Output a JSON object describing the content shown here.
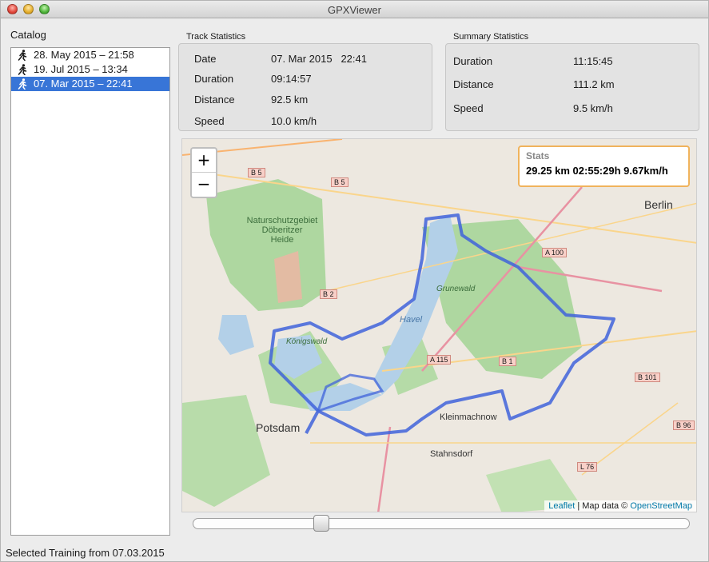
{
  "window": {
    "title": "GPXViewer"
  },
  "catalog": {
    "label": "Catalog",
    "items": [
      {
        "label": "28. May 2015 – 21:58",
        "icon": "runner-icon",
        "selected": false
      },
      {
        "label": "19. Jul 2015 – 13:34",
        "icon": "runner-icon",
        "selected": false
      },
      {
        "label": "07. Mar 2015 – 22:41",
        "icon": "runner-icon",
        "selected": true
      }
    ]
  },
  "track_stats": {
    "label": "Track Statistics",
    "rows": [
      {
        "key": "Date",
        "value": "07. Mar 2015   22:41"
      },
      {
        "key": "Duration",
        "value": "09:14:57"
      },
      {
        "key": "Distance",
        "value": "92.5 km"
      },
      {
        "key": "Speed",
        "value": "10.0 km/h"
      }
    ]
  },
  "summary_stats": {
    "label": "Summary Statistics",
    "rows": [
      {
        "key": "Duration",
        "value": "11:15:45"
      },
      {
        "key": "Distance",
        "value": "111.2 km"
      },
      {
        "key": "Speed",
        "value": "9.5 km/h"
      }
    ]
  },
  "map": {
    "zoom_in": "+",
    "zoom_out": "−",
    "stats_title": "Stats",
    "stats_text": "29.25 km 02:55:29h 9.67km/h",
    "attribution_leaflet": "Leaflet",
    "attribution_sep": " | Map data © ",
    "attribution_osm": "OpenStreetMap",
    "labels": {
      "berlin": "Berlin",
      "potsdam": "Potsdam",
      "kleinmachnow": "Kleinmachnow",
      "stahnsdorf": "Stahnsdorf",
      "nsg1": "Naturschutzgebiet",
      "nsg2": "Döberitzer",
      "nsg3": "Heide",
      "grunewald": "Grunewald",
      "havel": "Havel",
      "koenigswald": "Königswald",
      "b5a": "B 5",
      "b5b": "B 5",
      "b2": "B 2",
      "b1": "B 1",
      "b101": "B 101",
      "b96": "B 96",
      "a100": "A 100",
      "a115": "A 115",
      "l76": "L 76"
    },
    "colors": {
      "track": "#3f63db",
      "water": "#b3d0e8",
      "forest": "#aed7a0",
      "land": "#ede8e0"
    }
  },
  "slider": {
    "value_fraction": 0.25
  },
  "status": {
    "text": "Selected Training from 07.03.2015"
  }
}
